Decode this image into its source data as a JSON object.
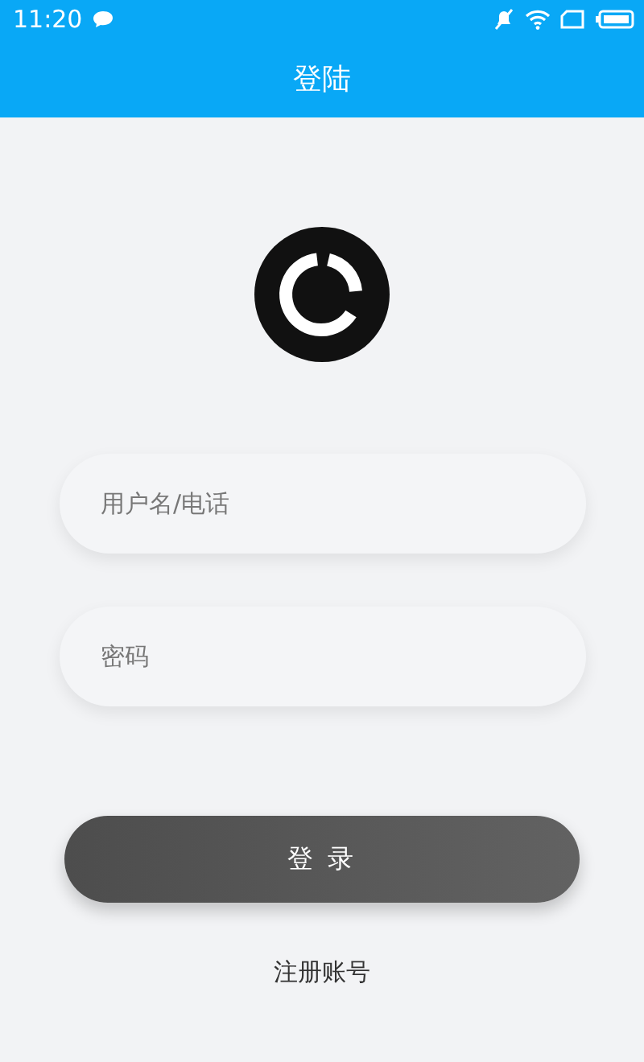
{
  "status_bar": {
    "time": "11:20"
  },
  "header": {
    "title": "登陆"
  },
  "fields": [
    {
      "placeholder": "用户名/电话"
    },
    {
      "placeholder": "密码"
    }
  ],
  "login_button": {
    "label": "登 录"
  },
  "register_link": {
    "label": "注册账号"
  }
}
